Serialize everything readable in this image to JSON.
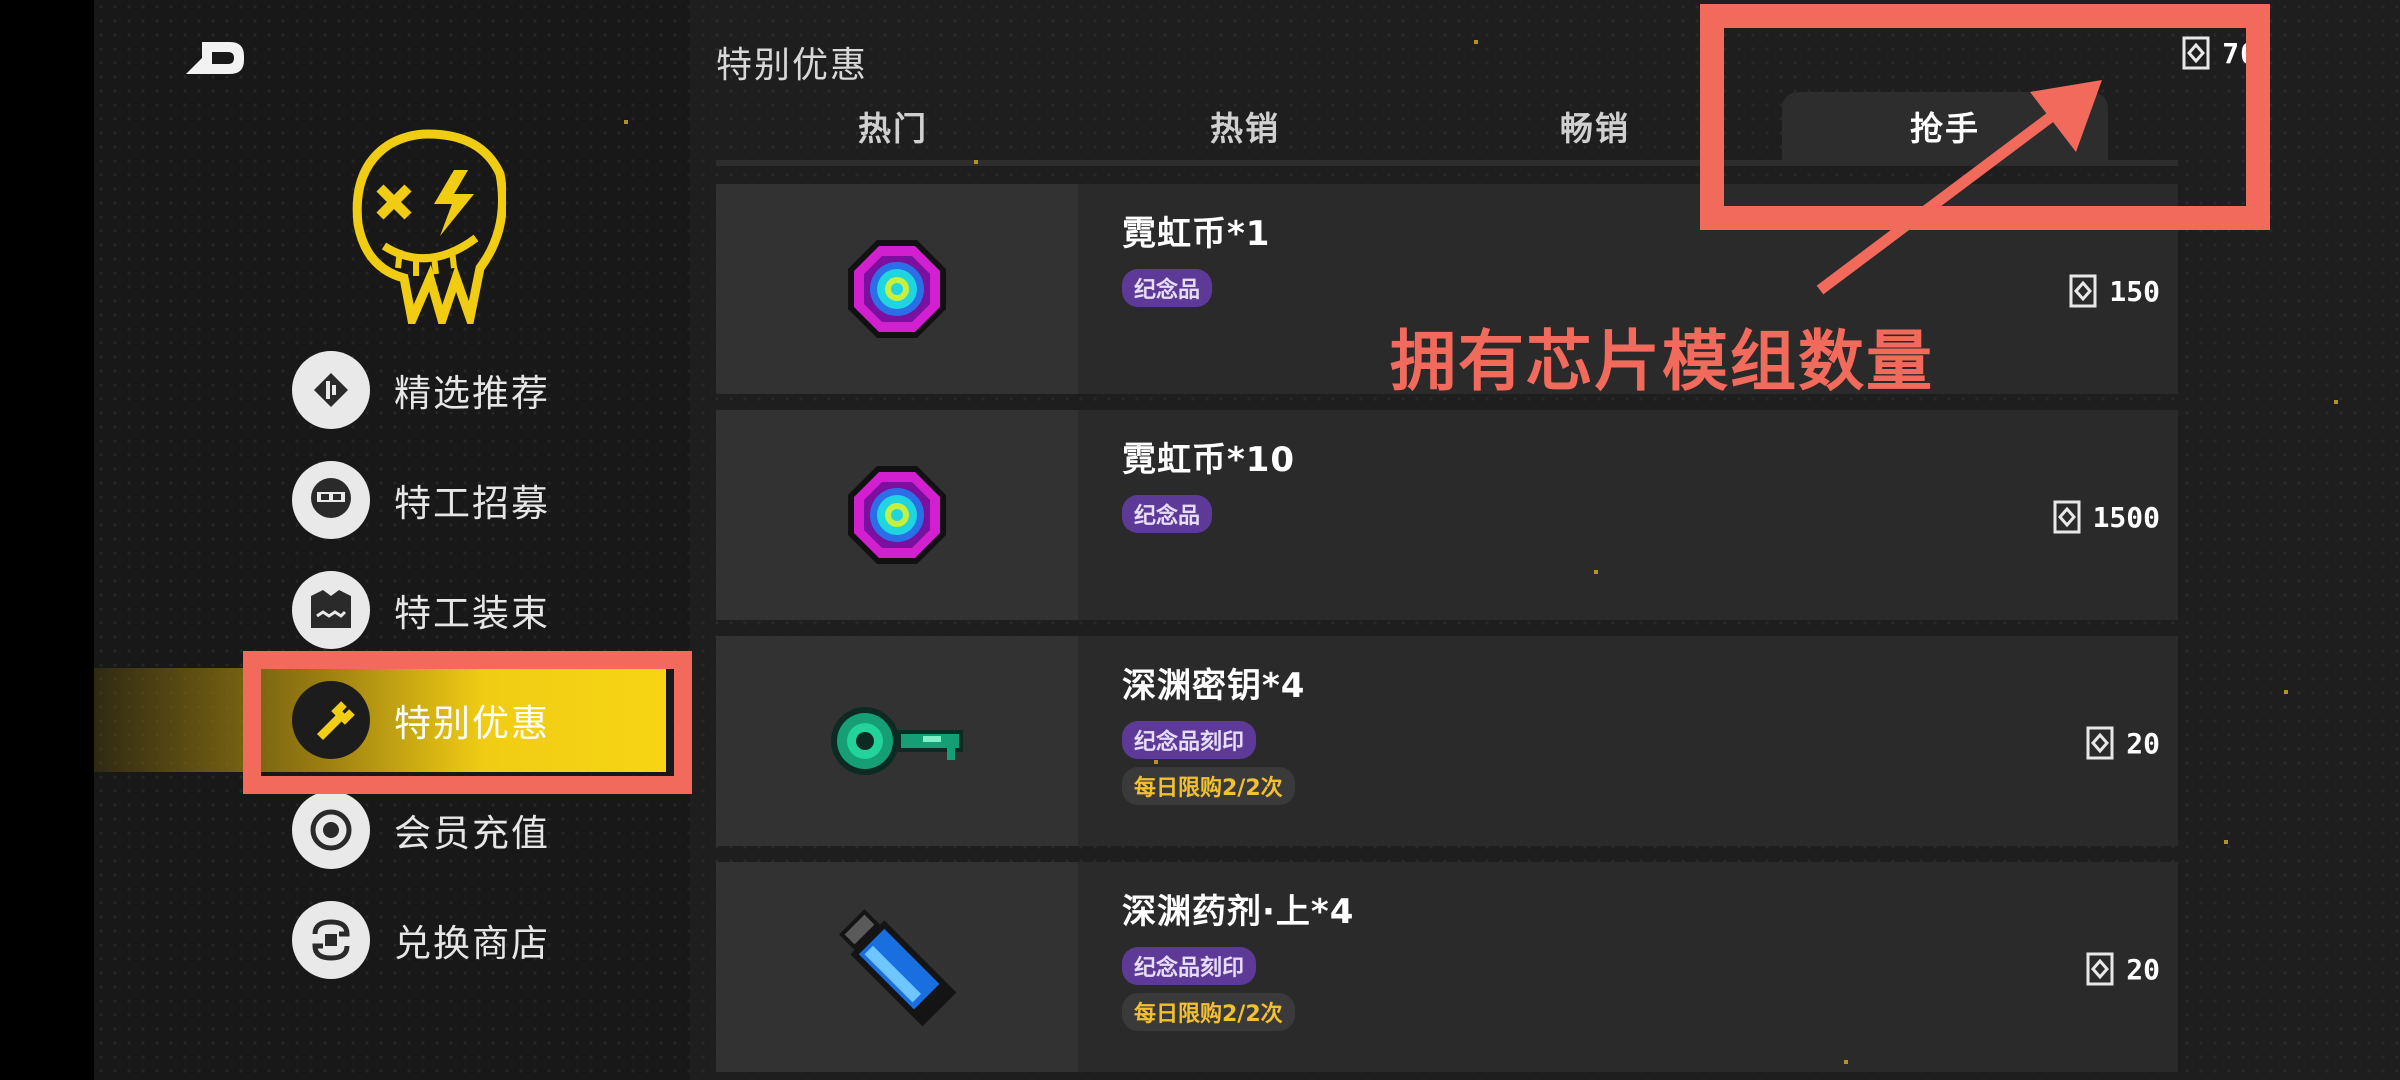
{
  "page": {
    "title": "特别优惠"
  },
  "currency": {
    "icon": "chip-module-icon",
    "value": "70"
  },
  "sidebar": {
    "items": [
      {
        "label": "精选推荐",
        "icon": "featured-icon"
      },
      {
        "label": "特工招募",
        "icon": "recruit-icon"
      },
      {
        "label": "特工装束",
        "icon": "outfit-icon"
      },
      {
        "label": "特别优惠",
        "icon": "special-offer-icon",
        "active": true
      },
      {
        "label": "会员充值",
        "icon": "membership-icon"
      },
      {
        "label": "兑换商店",
        "icon": "exchange-icon"
      }
    ]
  },
  "tabs": [
    {
      "label": "热门"
    },
    {
      "label": "热销"
    },
    {
      "label": "畅销"
    },
    {
      "label": "抢手",
      "selected": true
    }
  ],
  "items": [
    {
      "name": "霓虹币*1",
      "badge": "纪念品",
      "limit": "",
      "price": "150",
      "icon": "neon-coin-icon"
    },
    {
      "name": "霓虹币*10",
      "badge": "纪念品",
      "limit": "",
      "price": "1500",
      "icon": "neon-coin-icon"
    },
    {
      "name": "深渊密钥*4",
      "badge": "纪念品刻印",
      "limit": "每日限购2/2次",
      "price": "20",
      "icon": "abyss-key-icon"
    },
    {
      "name": "深渊药剂·上*4",
      "badge": "纪念品刻印",
      "limit": "每日限购2/2次",
      "price": "20",
      "icon": "abyss-potion-icon"
    }
  ],
  "annotation": {
    "text": "拥有芯片模组数量",
    "color": "#f26a5c"
  },
  "colors": {
    "accent": "#f7d514",
    "badge": "#5d3a97",
    "limit": "#f3c030",
    "annotation": "#f26a5c"
  }
}
